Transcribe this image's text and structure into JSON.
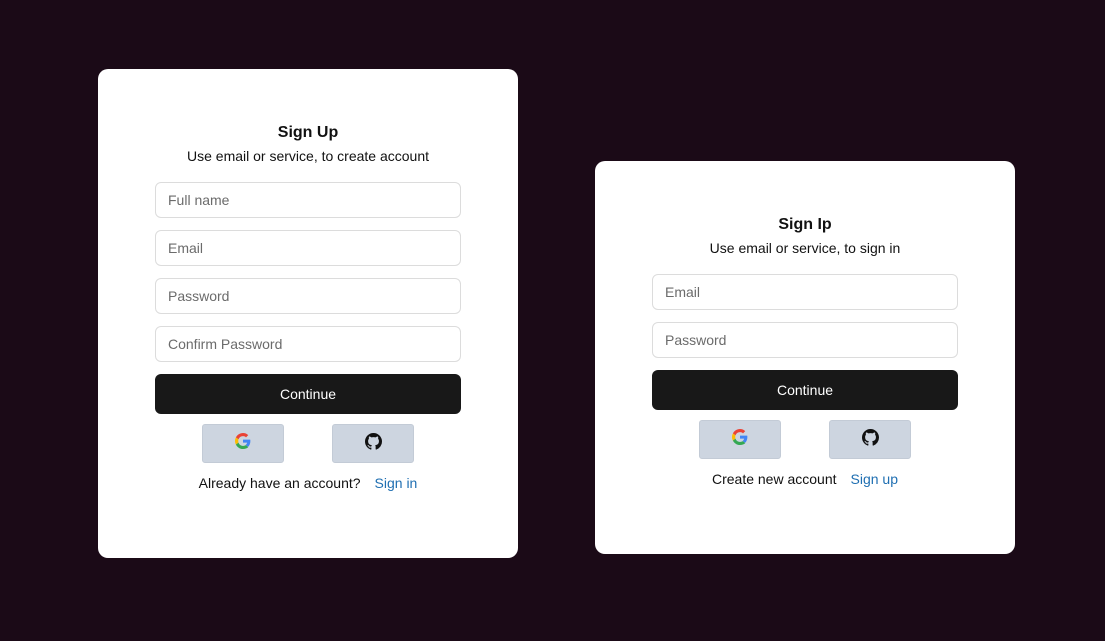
{
  "signup": {
    "title": "Sign Up",
    "subtitle": "Use email or service, to create account",
    "fields": [
      {
        "placeholder": "Full name"
      },
      {
        "placeholder": "Email"
      },
      {
        "placeholder": "Password"
      },
      {
        "placeholder": "Confirm Password"
      }
    ],
    "continue_label": "Continue",
    "footer_text": "Already have an account?",
    "footer_link": "Sign in"
  },
  "signin": {
    "title": "Sign Ip",
    "subtitle": "Use email or service, to sign in",
    "fields": [
      {
        "placeholder": "Email"
      },
      {
        "placeholder": "Password"
      }
    ],
    "continue_label": "Continue",
    "footer_text": "Create new account",
    "footer_link": "Sign up"
  },
  "icons": {
    "google": "google-icon",
    "github": "github-icon"
  },
  "colors": {
    "background": "#1b0a17",
    "button": "#181818",
    "link": "#1f6fb2",
    "social_bg": "#cdd5e0"
  }
}
